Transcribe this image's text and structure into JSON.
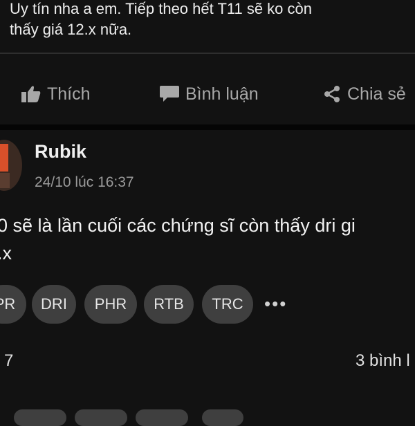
{
  "post1": {
    "text": "Uy tín nha a em. Tiếp theo hết  T11 sẽ ko còn\nthấy giá 12.x nữa."
  },
  "actions": {
    "like_label": "Thích",
    "comment_label": "Bình luận",
    "share_label": "Chia sẻ"
  },
  "post2": {
    "author": "Rubik",
    "timestamp": "24/10 lúc 16:37",
    "text": "0 sẽ là lần cuối các chứng sĩ còn thấy dri gi\n.x",
    "tags": [
      "PR",
      "DRI",
      "PHR",
      "RTB",
      "TRC"
    ],
    "more": "•••",
    "reaction_count": "7",
    "comment_count": "3 bình l"
  },
  "colors": {
    "background": "#121212",
    "tag_background": "#3f3f3f",
    "muted_text": "#a8a8a8"
  }
}
